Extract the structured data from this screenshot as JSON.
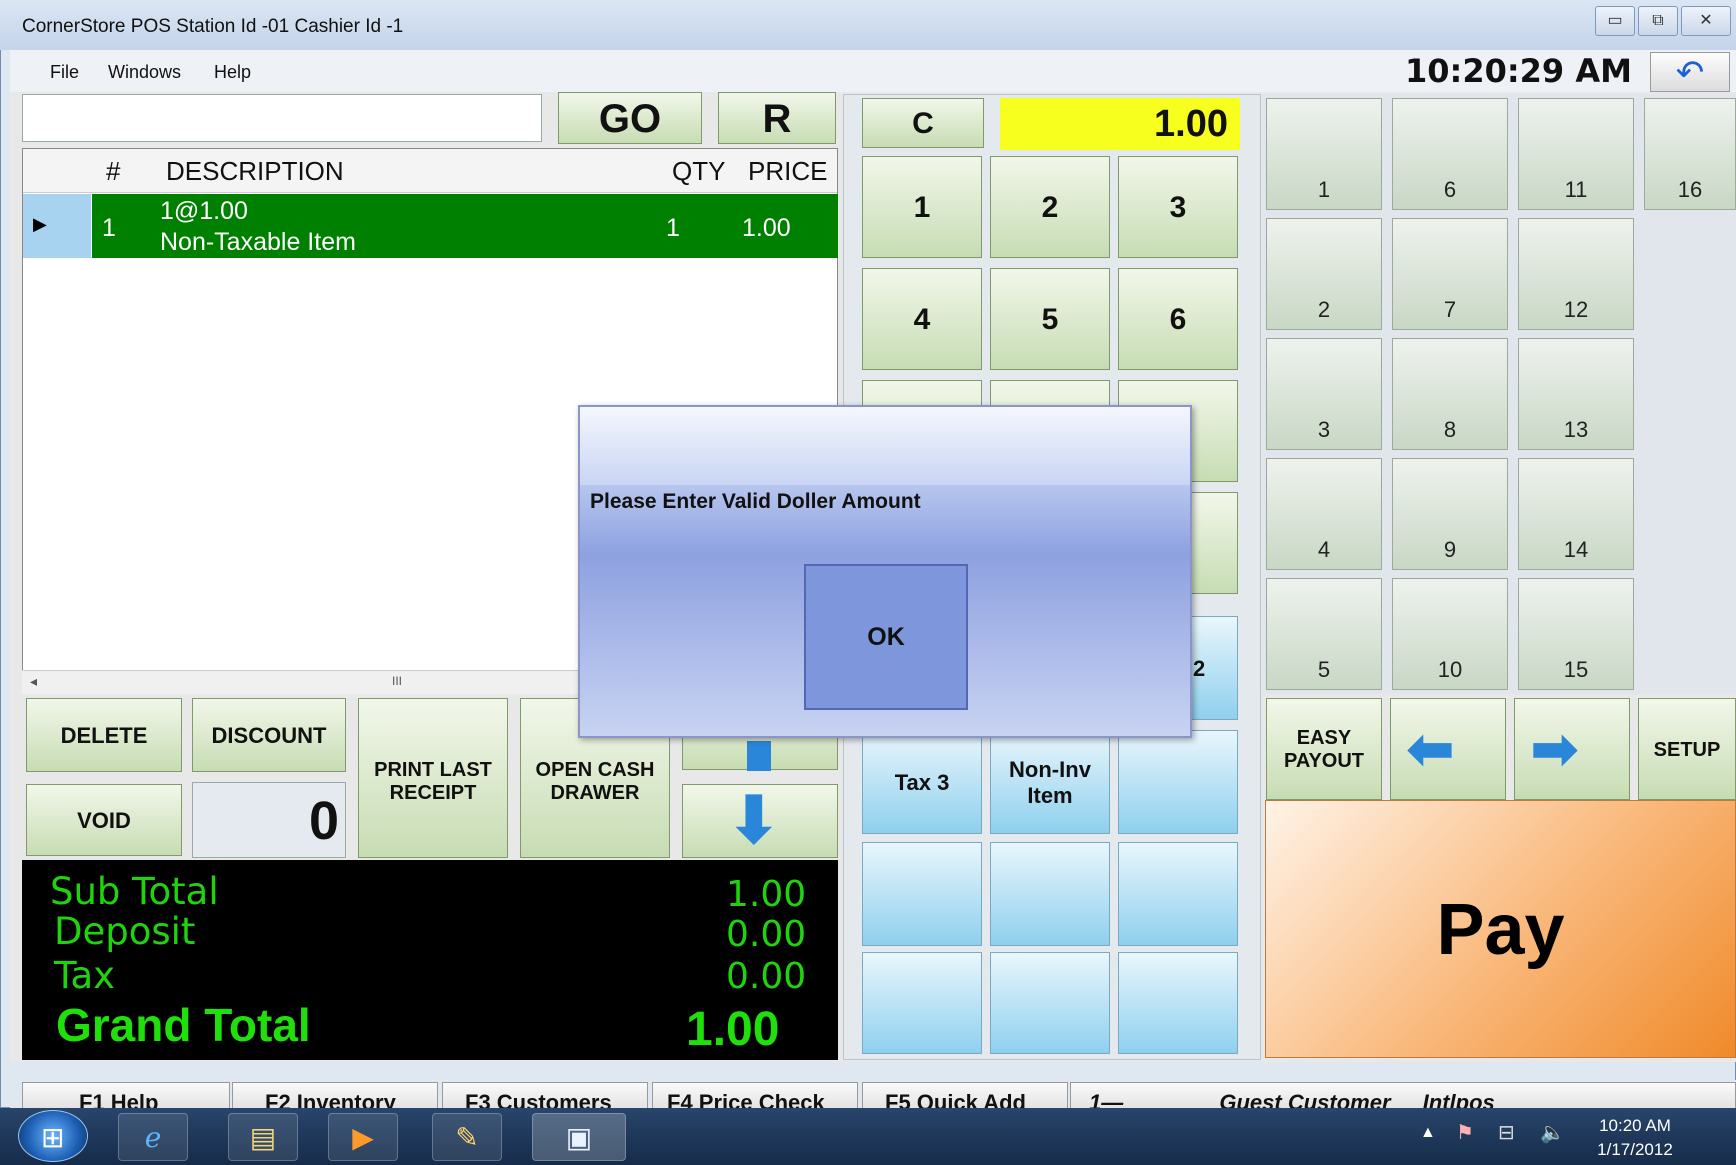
{
  "window": {
    "title": "CornerStore POS Station Id -01 Cashier Id -1",
    "minimize": "▭",
    "restore": "⧉",
    "close": "✕"
  },
  "menu": {
    "file": "File",
    "windows": "Windows",
    "help": "Help"
  },
  "clock": "10:20:29 AM",
  "undo_icon": "undo-arrow-icon",
  "search": {
    "value": ""
  },
  "buttons": {
    "go": "GO",
    "r": "R",
    "c": "C"
  },
  "display_amount": "1.00",
  "grid": {
    "headers": {
      "num": "#",
      "description": "DESCRIPTION",
      "qty": "QTY",
      "price": "PRICE"
    },
    "rows": [
      {
        "num": "1",
        "line1": "1@1.00",
        "line2": "Non-Taxable Item",
        "qty": "1",
        "price": "1.00"
      }
    ]
  },
  "scroll_grip": "III",
  "keypad": {
    "k1": "1",
    "k2": "2",
    "k3": "3",
    "k4": "4",
    "k5": "5",
    "k6": "6",
    "partial": "2"
  },
  "actions": {
    "delete": "DELETE",
    "discount": "DISCOUNT",
    "void": "VOID",
    "qty_value": "0",
    "print_last_receipt": "PRINT LAST RECEIPT",
    "open_cash_drawer": "OPEN CASH DRAWER"
  },
  "tax_buttons": {
    "tax3": "Tax 3",
    "non_inv": "Non-Inv Item"
  },
  "totals": {
    "sub_total_label": "Sub Total",
    "sub_total": "1.00",
    "deposit_label": "Deposit",
    "deposit": "0.00",
    "tax_label": "Tax",
    "tax": "0.00",
    "grand_total_label": "Grand Total",
    "grand_total": "1.00"
  },
  "quick_keys": [
    "1",
    "2",
    "3",
    "4",
    "5",
    "6",
    "7",
    "8",
    "9",
    "10",
    "11",
    "12",
    "13",
    "14",
    "15",
    "16"
  ],
  "nav": {
    "easy_payout": "EASY PAYOUT",
    "setup": "SETUP"
  },
  "pay": "Pay",
  "fkeys": [
    "F1 Help",
    "F2 Inventory",
    "F3 Customers",
    "F4 Price Check",
    "F5 Quick Add"
  ],
  "status": {
    "station": "1—",
    "customer": "Guest Customer",
    "profile": "Intlpos"
  },
  "dialog": {
    "message": "Please Enter Valid Doller Amount",
    "ok": "OK"
  },
  "taskbar": {
    "time": "10:20 AM",
    "date": "1/17/2012"
  }
}
